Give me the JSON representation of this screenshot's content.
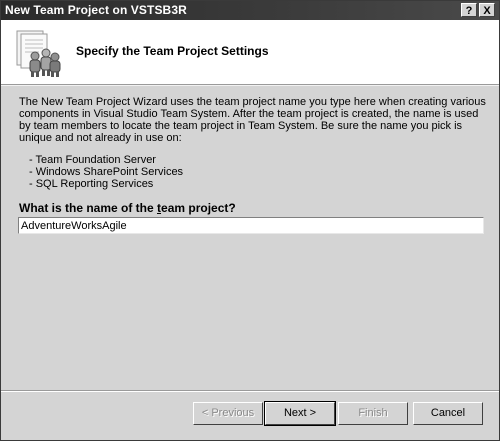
{
  "window": {
    "title": "New Team Project on VSTSB3R",
    "help_glyph": "?",
    "close_glyph": "X"
  },
  "header": {
    "title": "Specify the Team Project Settings",
    "icon": "team-project-people-icon"
  },
  "intro": {
    "text": "The New Team Project Wizard uses the team project name you type here when creating various components in Visual Studio Team System.  After the team project is created, the name is used by team members to locate the team project in Team System.  Be sure the name you pick is unique and not already in use on:"
  },
  "components": [
    "- Team Foundation Server",
    "- Windows SharePoint Services",
    "- SQL Reporting Services"
  ],
  "question": {
    "before": "What is the name of the ",
    "underlined": "t",
    "after": "eam project?"
  },
  "name_input": {
    "value": "AdventureWorksAgile"
  },
  "buttons": {
    "previous": "< Previous",
    "next": "Next >",
    "finish": "Finish",
    "cancel": "Cancel"
  },
  "colors": {
    "titlebar": "#2b2b2b",
    "dialog_bg": "#d4d4d4",
    "header_bg": "#ffffff",
    "disabled_text": "#8a8a8a"
  }
}
